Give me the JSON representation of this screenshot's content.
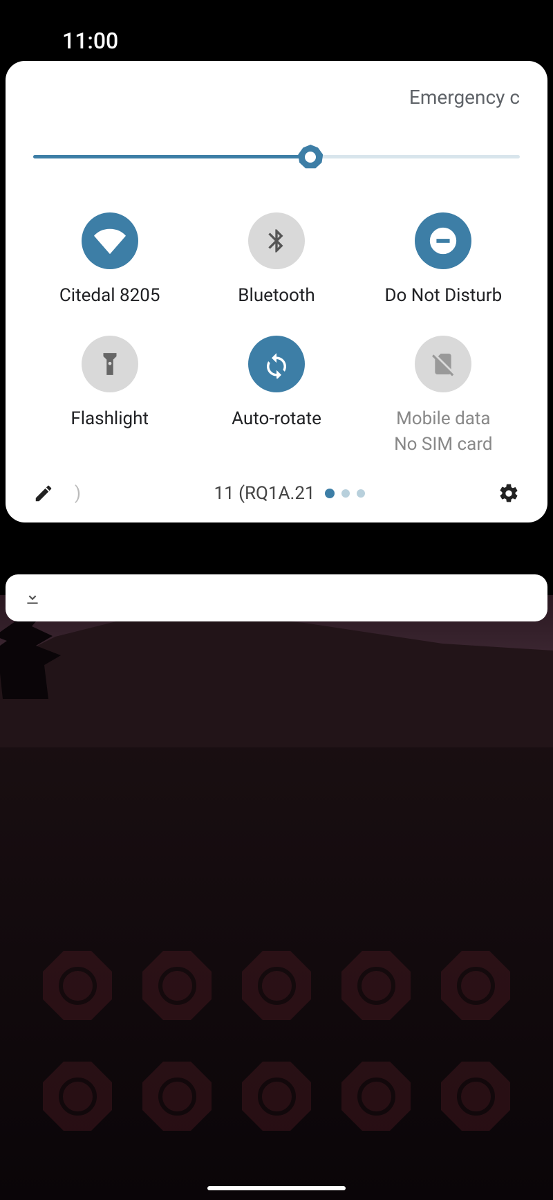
{
  "status_bar": {
    "time": "11:00"
  },
  "panel": {
    "header_text": "Emergency c",
    "brightness_percent": 57,
    "build_text": "11 (RQ1A.21",
    "paren": ")"
  },
  "tiles": [
    {
      "label": "Citedal 8205",
      "active": true,
      "icon": "wifi"
    },
    {
      "label": "Bluetooth",
      "active": false,
      "icon": "bluetooth"
    },
    {
      "label": "Do Not Disturb",
      "active": true,
      "icon": "dnd"
    },
    {
      "label": "Flashlight",
      "active": false,
      "icon": "flashlight"
    },
    {
      "label": "Auto-rotate",
      "active": true,
      "icon": "rotate"
    },
    {
      "label": "Mobile data",
      "sub": "No SIM card",
      "active": false,
      "disabled": true,
      "icon": "nosim"
    }
  ],
  "colors": {
    "accent": "#3d7ea6",
    "inactive": "#d9d9d9"
  }
}
